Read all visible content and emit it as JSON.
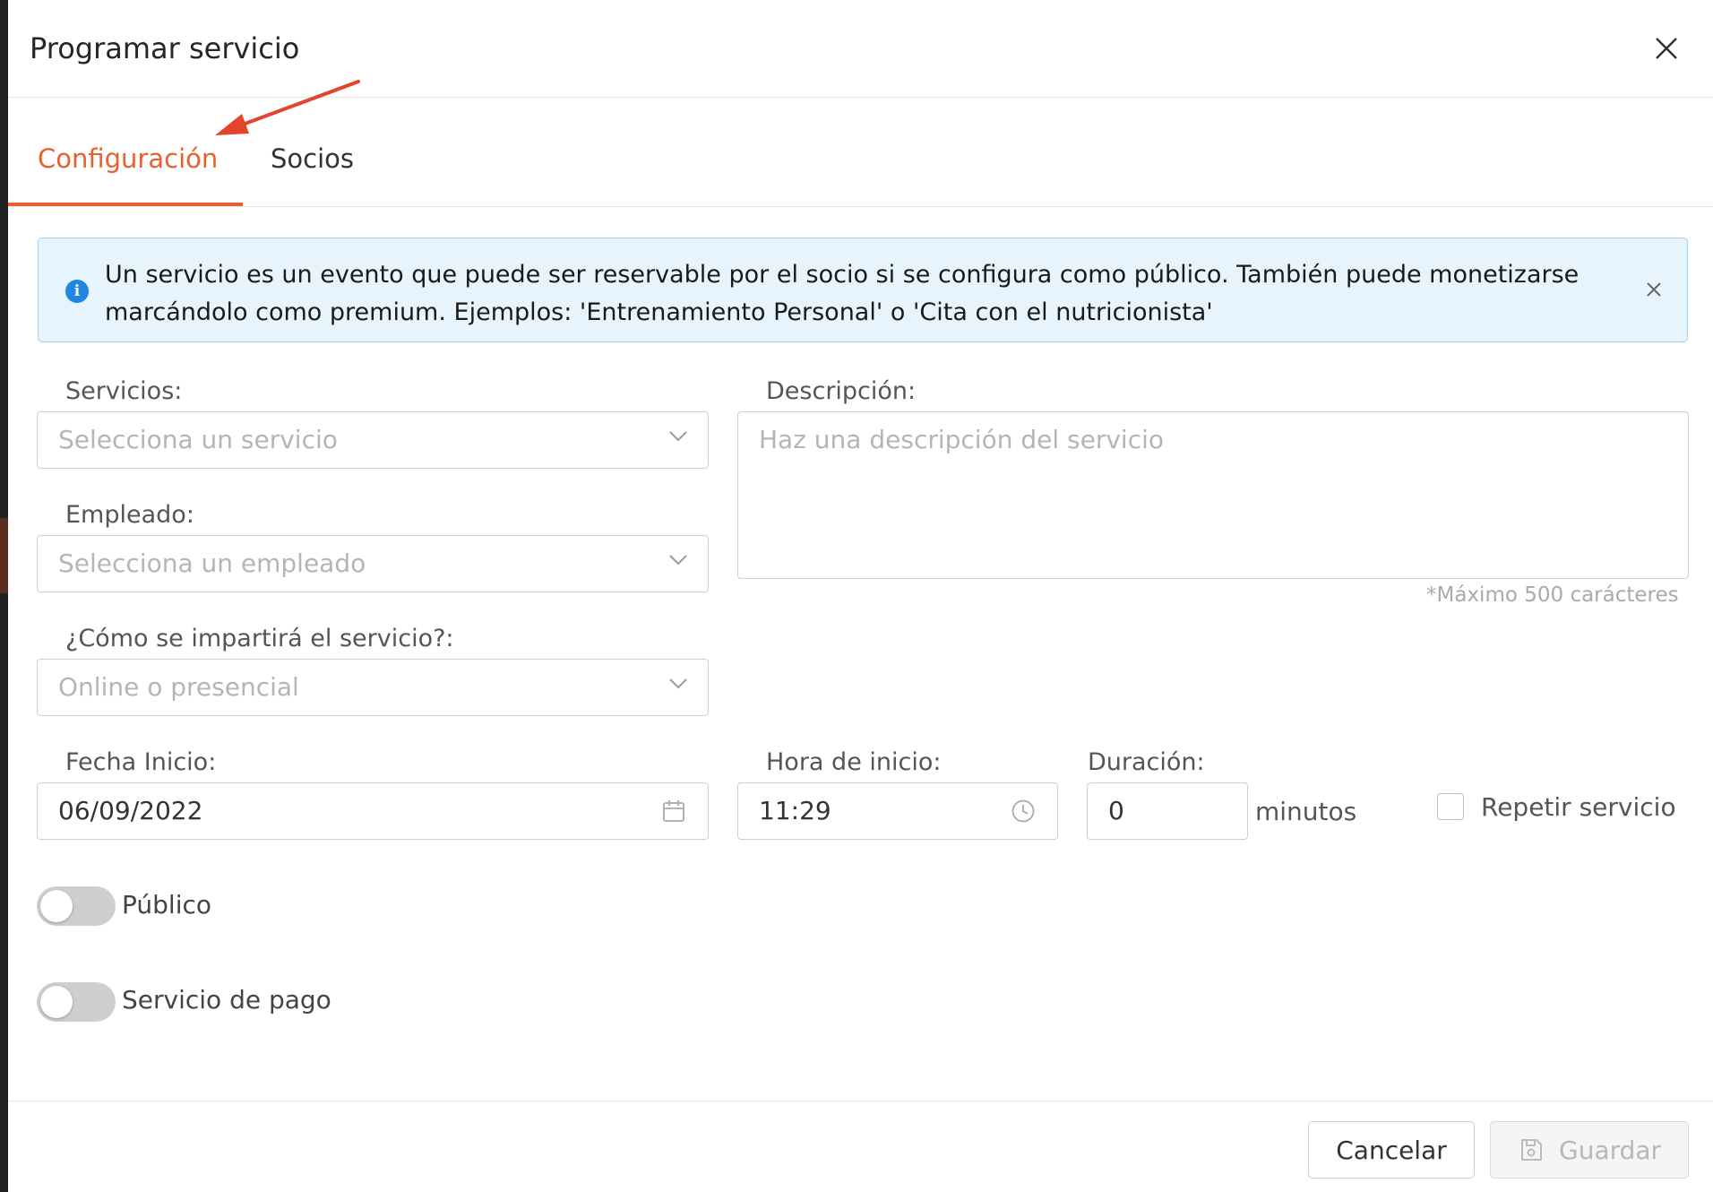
{
  "dialog": {
    "title": "Programar servicio"
  },
  "tabs": [
    {
      "label": "Configuración",
      "active": true
    },
    {
      "label": "Socios",
      "active": false
    }
  ],
  "alert": {
    "text": "Un servicio es un evento que puede ser reservable por el socio si se configura como público. También puede monetizarse marcándolo como premium. Ejemplos: 'Entrenamiento Personal' o 'Cita con el nutricionista'"
  },
  "form": {
    "servicios": {
      "label": "Servicios:",
      "placeholder": "Selecciona un servicio"
    },
    "empleado": {
      "label": "Empleado:",
      "placeholder": "Selecciona un empleado"
    },
    "modalidad": {
      "label": "¿Cómo se impartirá el servicio?:",
      "placeholder": "Online o presencial"
    },
    "descripcion": {
      "label": "Descripción:",
      "placeholder": "Haz una descripción del servicio",
      "counter": "*Máximo 500 carácteres"
    },
    "fecha_inicio": {
      "label": "Fecha Inicio:",
      "value": "06/09/2022"
    },
    "hora_inicio": {
      "label": "Hora de inicio:",
      "value": "11:29"
    },
    "duracion": {
      "label": "Duración:",
      "value": "0",
      "unit": "minutos"
    },
    "repetir": {
      "label": "Repetir servicio",
      "checked": false
    },
    "publico": {
      "label": "Público",
      "on": false
    },
    "pago": {
      "label": "Servicio de pago",
      "on": false
    }
  },
  "footer": {
    "cancel_label": "Cancelar",
    "save_label": "Guardar"
  },
  "colors": {
    "accent": "#e8612c",
    "info": "#1f86e3",
    "alert_bg": "#e8f4fd"
  }
}
